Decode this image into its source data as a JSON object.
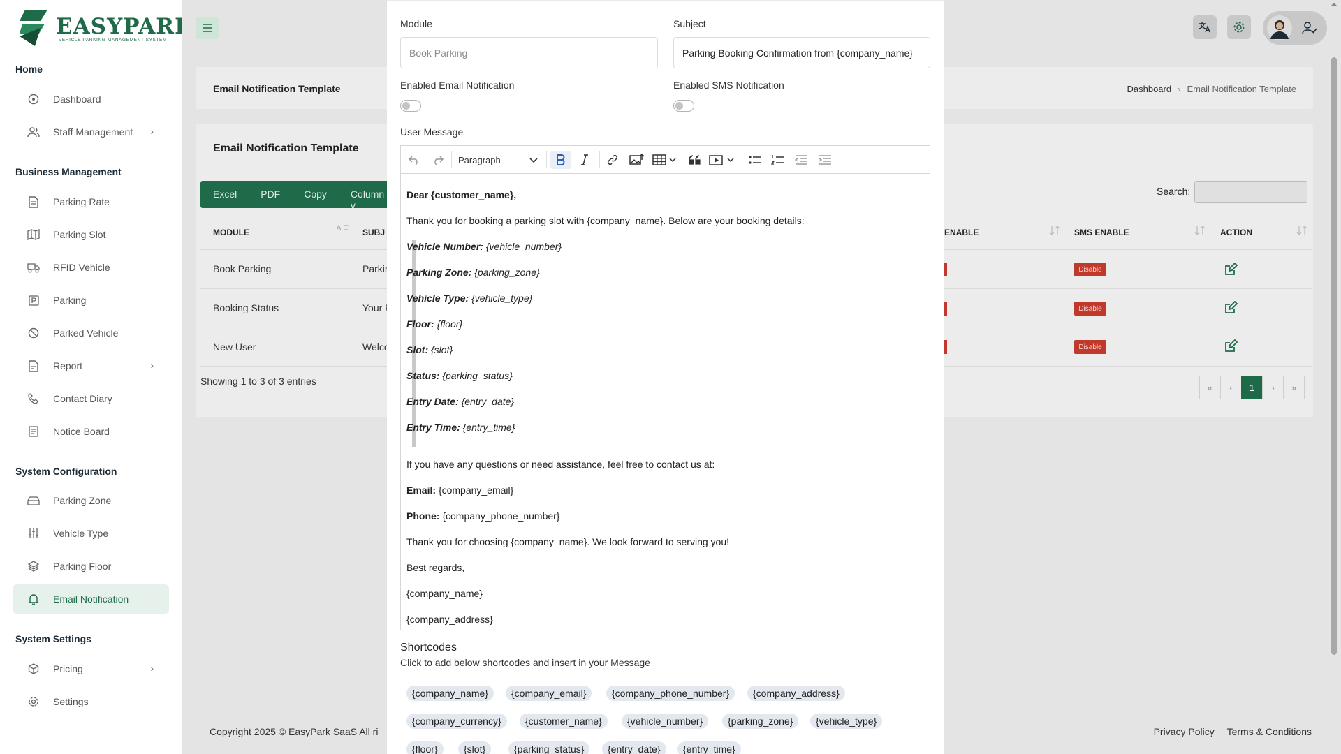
{
  "brand": {
    "name": "EASYPARK",
    "tagline": "VEHICLE PARKING MANAGEMENT SYSTEM"
  },
  "sidebar": {
    "sections": [
      {
        "title": "Home",
        "items": [
          {
            "label": "Dashboard",
            "icon": "dashboard-icon"
          },
          {
            "label": "Staff Management",
            "icon": "users-icon",
            "has_children": true
          }
        ]
      },
      {
        "title": "Business Management",
        "items": [
          {
            "label": "Parking Rate",
            "icon": "document-icon"
          },
          {
            "label": "Parking Slot",
            "icon": "map-icon"
          },
          {
            "label": "RFID Vehicle",
            "icon": "truck-icon"
          },
          {
            "label": "Parking",
            "icon": "parking-icon"
          },
          {
            "label": "Parked Vehicle",
            "icon": "ban-icon"
          },
          {
            "label": "Report",
            "icon": "report-icon",
            "has_children": true
          },
          {
            "label": "Contact Diary",
            "icon": "phone-icon"
          },
          {
            "label": "Notice Board",
            "icon": "notice-icon"
          }
        ]
      },
      {
        "title": "System Configuration",
        "items": [
          {
            "label": "Parking Zone",
            "icon": "zone-icon"
          },
          {
            "label": "Vehicle Type",
            "icon": "sliders-icon"
          },
          {
            "label": "Parking Floor",
            "icon": "layers-icon"
          },
          {
            "label": "Email Notification",
            "icon": "bell-icon",
            "active": true
          }
        ]
      },
      {
        "title": "System Settings",
        "items": [
          {
            "label": "Pricing",
            "icon": "box-icon",
            "has_children": true
          },
          {
            "label": "Settings",
            "icon": "gear-icon"
          }
        ]
      }
    ]
  },
  "page": {
    "breadcrumb_title": "Email Notification Template",
    "breadcrumbs": [
      "Dashboard",
      "Email Notification Template"
    ],
    "card_title": "Email Notification Template",
    "export_buttons": [
      "Excel",
      "PDF",
      "Copy",
      "Column v"
    ],
    "search_label": "Search:",
    "columns": [
      "MODULE",
      "SUBJ",
      "ENABLE",
      "SMS ENABLE",
      "ACTION"
    ],
    "rows": [
      {
        "module": "Book Parking",
        "subject": "Parkin",
        "sms": "Disable"
      },
      {
        "module": "Booking Status",
        "subject": "Your P",
        "sms": "Disable"
      },
      {
        "module": "New User",
        "subject": "Welco",
        "sms": "Disable"
      }
    ],
    "showing": "Showing 1 to 3 of 3 entries",
    "pager": [
      "«",
      "‹",
      "1",
      "›",
      "»"
    ],
    "copyright": "Copyright 2025 © EasyPark SaaS All ri",
    "footer_links": [
      "Privacy Policy",
      "Terms & Conditions"
    ]
  },
  "modal": {
    "module_label": "Module",
    "module_placeholder": "Book Parking",
    "subject_label": "Subject",
    "subject_value": "Parking Booking Confirmation from {company_name}",
    "email_toggle_label": "Enabled Email Notification",
    "sms_toggle_label": "Enabled SMS Notification",
    "message_label": "User Message",
    "paragraph_select": "Paragraph",
    "message": {
      "greeting": "Dear {customer_name},",
      "intro": "Thank you for booking a parking slot with {company_name}. Below are your booking details:",
      "details": [
        {
          "k": "Vehicle Number:",
          "v": "{vehicle_number}"
        },
        {
          "k": "Parking Zone:",
          "v": "{parking_zone}"
        },
        {
          "k": "Vehicle Type:",
          "v": "{vehicle_type}"
        },
        {
          "k": "Floor:",
          "v": "{floor}"
        },
        {
          "k": "Slot:",
          "v": "{slot}"
        },
        {
          "k": "Status:",
          "v": "{parking_status}"
        },
        {
          "k": "Entry Date:",
          "v": "{entry_date}"
        },
        {
          "k": "Entry Time:",
          "v": "{entry_time}"
        }
      ],
      "questions": "If you have any questions or need assistance, feel free to contact us at:",
      "email_k": "Email:",
      "email_v": " {company_email}",
      "phone_k": "Phone:",
      "phone_v": " {company_phone_number}",
      "thanks": "Thank you for choosing {company_name}. We look forward to serving you!",
      "regards": "Best regards,",
      "sign_name": "{company_name}",
      "sign_address": "{company_address}"
    },
    "shortcodes_title": "Shortcodes",
    "shortcodes_sub": "Click to add below shortcodes and insert in your Message",
    "shortcodes": [
      "{company_name}",
      "{company_email}",
      "{company_phone_number}",
      "{company_address}",
      "{company_currency}",
      "{customer_name}",
      "{vehicle_number}",
      "{parking_zone}",
      "{vehicle_type}",
      "{floor}",
      "{slot}",
      "{parking_status}",
      "{entry_date}",
      "{entry_time}"
    ]
  },
  "colors": {
    "brand": "#1f6b49",
    "active_bg": "#e6f1eb",
    "danger": "#c0392b"
  }
}
